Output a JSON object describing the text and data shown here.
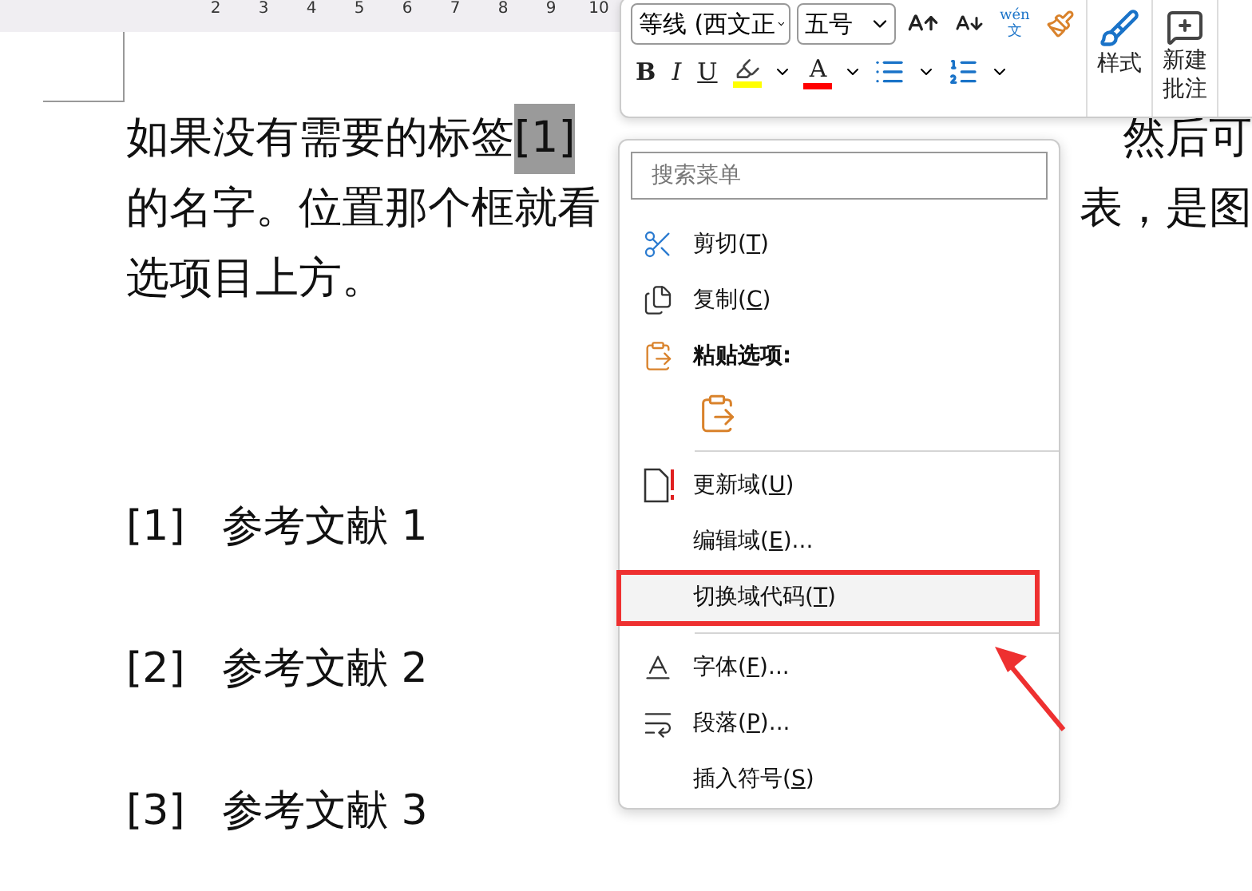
{
  "ruler": {
    "numbers": [
      "2",
      "3",
      "4",
      "5",
      "6",
      "7",
      "8",
      "9",
      "10"
    ]
  },
  "document": {
    "lines": [
      {
        "left": "如果没有需要的标签",
        "field": "[1]",
        "right": "然后可"
      },
      {
        "left": "的名字。位置那个框就看",
        "right": "表，是图"
      },
      {
        "left": "选项目上方。"
      }
    ],
    "references": [
      {
        "mark": "[1]",
        "text": "参考文献 1"
      },
      {
        "mark": "[2]",
        "text": "参考文献 2"
      },
      {
        "mark": "[3]",
        "text": "参考文献 3"
      }
    ]
  },
  "mini_toolbar": {
    "font": "等线 (西文正",
    "size": "五号",
    "phonetic": {
      "pinyin": "wén",
      "char": "文"
    },
    "format_buttons": [
      {
        "kind": "text",
        "label": "B"
      },
      {
        "kind": "text",
        "label": "I"
      },
      {
        "kind": "text",
        "label": "U"
      },
      {
        "kind": "highlight",
        "color": "#ffff00"
      },
      {
        "kind": "fontcolor",
        "label": "A",
        "color": "#ff0000"
      },
      {
        "kind": "bullets"
      },
      {
        "kind": "numbering"
      }
    ],
    "styles": {
      "label": "样式"
    },
    "comment": {
      "lines": [
        "新建",
        "批注"
      ]
    }
  },
  "context_menu": {
    "search": {
      "placeholder": "搜索菜单"
    },
    "items": [
      {
        "kind": "item",
        "pre": "剪切(",
        "key": "T",
        "post": ")",
        "selected": false,
        "boxed": false
      },
      {
        "kind": "item",
        "pre": "复制(",
        "key": "C",
        "post": ")",
        "selected": false,
        "boxed": false
      },
      {
        "kind": "heading",
        "label": "粘贴选项:"
      },
      {
        "kind": "paste-options"
      },
      {
        "kind": "separator"
      },
      {
        "kind": "item",
        "pre": "更新域(",
        "key": "U",
        "post": ")",
        "selected": false,
        "boxed": false
      },
      {
        "kind": "item",
        "pre": "编辑域(",
        "key": "E",
        "post": ")...",
        "selected": false,
        "boxed": false
      },
      {
        "kind": "item",
        "pre": "切换域代码(",
        "key": "T",
        "post": ")",
        "selected": true,
        "boxed": true
      },
      {
        "kind": "separator"
      },
      {
        "kind": "item",
        "pre": "字体(",
        "key": "F",
        "post": ")...",
        "selected": false,
        "boxed": false
      },
      {
        "kind": "item",
        "pre": "段落(",
        "key": "P",
        "post": ")...",
        "selected": false,
        "boxed": false
      },
      {
        "kind": "item",
        "pre": "插入符号(",
        "key": "S",
        "post": ")",
        "selected": false,
        "boxed": false
      }
    ]
  }
}
